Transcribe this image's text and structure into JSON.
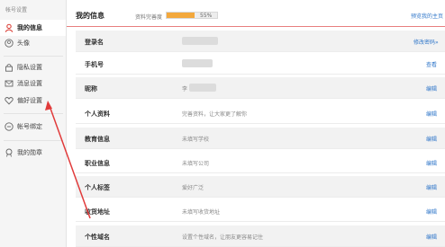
{
  "sidebar": {
    "section_title": "帐号设置",
    "items": [
      {
        "label": "我的信息",
        "icon": "user-icon"
      },
      {
        "label": "头像",
        "icon": "avatar-icon"
      },
      {
        "label": "隐私设置",
        "icon": "lock-icon"
      },
      {
        "label": "消息设置",
        "icon": "message-icon"
      },
      {
        "label": "偏好设置",
        "icon": "heart-icon"
      },
      {
        "label": "帐号绑定",
        "icon": "link-icon"
      },
      {
        "label": "我的勋章",
        "icon": "medal-icon"
      }
    ]
  },
  "header": {
    "title": "我的信息",
    "completeness_label": "资料完善度",
    "completeness_percent": "55%",
    "completeness_value": 0.55,
    "link": "预览我的主页"
  },
  "rows": [
    {
      "label": "登录名",
      "value": "",
      "action": "修改密码»"
    },
    {
      "label": "手机号",
      "value": "",
      "action": "查看"
    },
    {
      "label": "昵称",
      "value": "李",
      "action": "编辑"
    },
    {
      "label": "个人资料",
      "value": "完善资料，让大家更了解你",
      "action": "编辑"
    },
    {
      "label": "教育信息",
      "value": "未填写学校",
      "action": "编辑"
    },
    {
      "label": "职业信息",
      "value": "未填写公司",
      "action": "编辑"
    },
    {
      "label": "个人标签",
      "value": "爱好广泛",
      "action": "编辑"
    },
    {
      "label": "收货地址",
      "value": "未填写收货地址",
      "action": "编辑"
    },
    {
      "label": "个性域名",
      "value": "设置个性域名，让朋友更容易记住",
      "action": "编辑"
    }
  ],
  "colors": {
    "accent_red": "#e13b3b",
    "link_blue": "#2f76c9",
    "progress_orange": "#f3a83c"
  }
}
